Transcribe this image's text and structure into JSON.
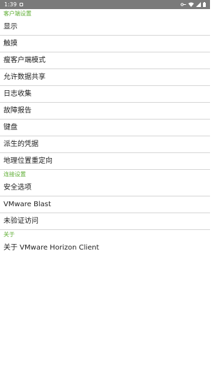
{
  "status_bar": {
    "time": "1:39",
    "icons": [
      "notification-icon",
      "key-icon",
      "wifi-icon",
      "signal-icon",
      "battery-icon"
    ]
  },
  "sections": [
    {
      "header": "客户端设置",
      "items": [
        "显示",
        "触摸",
        "瘦客户端模式",
        "允许数据共享",
        "日志收集",
        "故障报告",
        "键盘",
        "派生的凭据",
        "地理位置重定向"
      ]
    },
    {
      "header": "连接设置",
      "items": [
        "安全选项",
        "VMware Blast",
        "未验证访问"
      ]
    },
    {
      "header": "关于",
      "items": [
        "关于 VMware Horizon Client"
      ]
    }
  ],
  "colors": {
    "status_bar_bg": "#7a7a7a",
    "section_header": "#5fae34",
    "divider": "#d6d6d6"
  }
}
